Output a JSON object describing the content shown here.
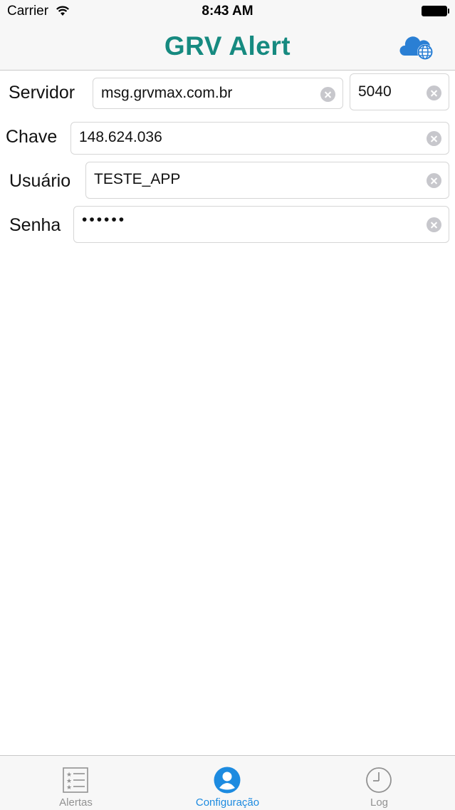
{
  "status_bar": {
    "carrier": "Carrier",
    "time": "8:43 AM"
  },
  "nav": {
    "title": "GRV Alert",
    "title_color": "#168a80",
    "action_icon": "cloud-globe-icon"
  },
  "form": {
    "servidor": {
      "label": "Servidor",
      "host": "msg.grvmax.com.br",
      "port": "5040"
    },
    "chave": {
      "label": "Chave",
      "value": "148.624.036"
    },
    "usuario": {
      "label": "Usuário",
      "value": "TESTE_APP"
    },
    "senha": {
      "label": "Senha",
      "value": "••••••"
    }
  },
  "tabs": [
    {
      "label": "Alertas",
      "icon": "list-icon",
      "active": false
    },
    {
      "label": "Configuração",
      "icon": "person-icon",
      "active": true
    },
    {
      "label": "Log",
      "icon": "clock-icon",
      "active": false
    }
  ],
  "colors": {
    "accent": "#1d8be0",
    "inactive": "#929292"
  }
}
